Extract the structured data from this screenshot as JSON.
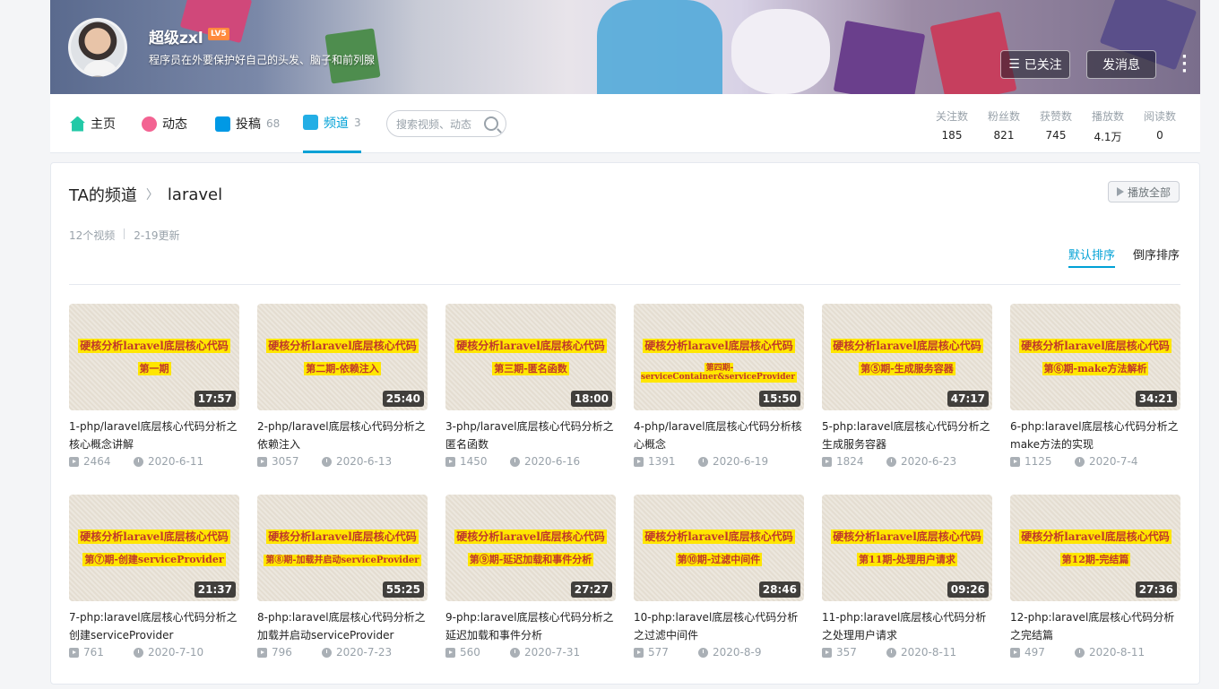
{
  "header": {
    "username": "超级zxl",
    "level": "LV5",
    "signature": "程序员在外要保护好自己的头发、脑子和前列腺",
    "follow_label": "已关注",
    "message_label": "发消息"
  },
  "nav": {
    "tabs": [
      {
        "label": "主页",
        "count": ""
      },
      {
        "label": "动态",
        "count": ""
      },
      {
        "label": "投稿",
        "count": "68"
      },
      {
        "label": "频道",
        "count": "3"
      }
    ],
    "search_placeholder": "搜索视频、动态",
    "stats": [
      {
        "label": "关注数",
        "value": "185"
      },
      {
        "label": "粉丝数",
        "value": "821"
      },
      {
        "label": "获赞数",
        "value": "745"
      },
      {
        "label": "播放数",
        "value": "4.1万"
      },
      {
        "label": "阅读数",
        "value": "0"
      }
    ]
  },
  "channel": {
    "breadcrumb_root": "TA的频道",
    "breadcrumb_current": "laravel",
    "play_all": "播放全部",
    "video_count": "12个视频",
    "updated": "2-19更新",
    "sort_default": "默认排序",
    "sort_reverse": "倒序排序"
  },
  "videos": [
    {
      "thumb1": "硬核分析laravel底层核心代码",
      "thumb2": "第一期",
      "duration": "17:57",
      "title": "1-php/laravel底层核心代码分析之核心概念讲解",
      "views": "2464",
      "date": "2020-6-11"
    },
    {
      "thumb1": "硬核分析laravel底层核心代码",
      "thumb2": "第二期-依赖注入",
      "duration": "25:40",
      "title": "2-php/laravel底层核心代码分析之依赖注入",
      "views": "3057",
      "date": "2020-6-13"
    },
    {
      "thumb1": "硬核分析laravel底层核心代码",
      "thumb2": "第三期-匿名函数",
      "duration": "18:00",
      "title": "3-php/laravel底层核心代码分析之匿名函数",
      "views": "1450",
      "date": "2020-6-16"
    },
    {
      "thumb1": "硬核分析laravel底层核心代码",
      "thumb2": "第四期-serviceContainer&serviceProvider",
      "duration": "15:50",
      "title": "4-php/laravel底层核心代码分析核心概念",
      "views": "1391",
      "date": "2020-6-19"
    },
    {
      "thumb1": "硬核分析laravel底层核心代码",
      "thumb2": "第⑤期-生成服务容器",
      "duration": "47:17",
      "title": "5-php:laravel底层核心代码分析之生成服务容器",
      "views": "1824",
      "date": "2020-6-23"
    },
    {
      "thumb1": "硬核分析laravel底层核心代码",
      "thumb2": "第⑥期-make方法解析",
      "duration": "34:21",
      "title": "6-php:laravel底层核心代码分析之make方法的实现",
      "views": "1125",
      "date": "2020-7-4"
    },
    {
      "thumb1": "硬核分析laravel底层核心代码",
      "thumb2": "第⑦期-创建serviceProvider",
      "duration": "21:37",
      "title": "7-php:laravel底层核心代码分析之创建serviceProvider",
      "views": "761",
      "date": "2020-7-10"
    },
    {
      "thumb1": "硬核分析laravel底层核心代码",
      "thumb2": "第⑧期-加载并启动serviceProvider",
      "duration": "55:25",
      "title": "8-php:laravel底层核心代码分析之加载并启动serviceProvider",
      "views": "796",
      "date": "2020-7-23"
    },
    {
      "thumb1": "硬核分析laravel底层核心代码",
      "thumb2": "第⑨期-延迟加载和事件分析",
      "duration": "27:27",
      "title": "9-php:laravel底层核心代码分析之延迟加载和事件分析",
      "views": "560",
      "date": "2020-7-31"
    },
    {
      "thumb1": "硬核分析laravel底层核心代码",
      "thumb2": "第⑩期-过滤中间件",
      "duration": "28:46",
      "title": "10-php:laravel底层核心代码分析之过滤中间件",
      "views": "577",
      "date": "2020-8-9"
    },
    {
      "thumb1": "硬核分析laravel底层核心代码",
      "thumb2": "第11期-处理用户请求",
      "duration": "09:26",
      "title": "11-php:laravel底层核心代码分析之处理用户请求",
      "views": "357",
      "date": "2020-8-11"
    },
    {
      "thumb1": "硬核分析laravel底层核心代码",
      "thumb2": "第12期-完结篇",
      "duration": "27:36",
      "title": "12-php:laravel底层核心代码分析之完结篇",
      "views": "497",
      "date": "2020-8-11"
    }
  ],
  "colors": {
    "accent": "#00a1d6",
    "level_badge": "#ff8a3d",
    "thumb_highlight": "#ffe600"
  }
}
